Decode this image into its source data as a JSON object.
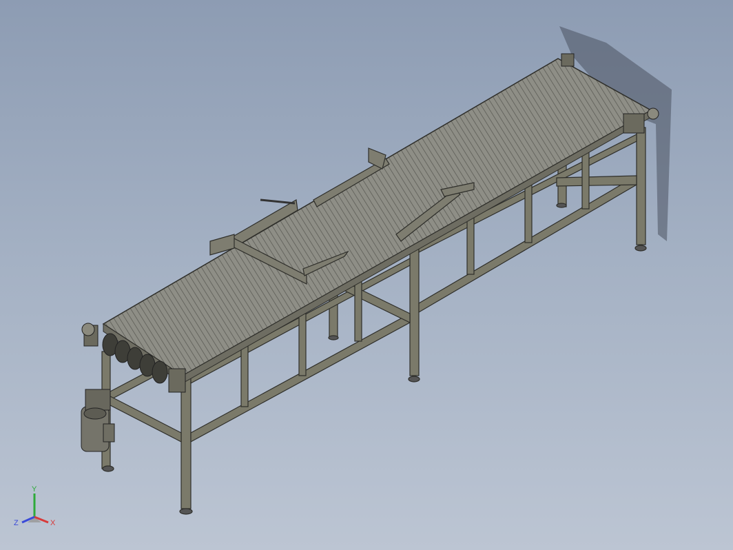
{
  "viewport": {
    "background_top": "#8d9cb3",
    "background_bottom": "#bcc5d3"
  },
  "model": {
    "name": "conveyor-assembly",
    "belt_color": "#8c8c83",
    "frame_color": "#7b7a6a",
    "edge_color": "#2e2e2a"
  },
  "triad": {
    "x_label": "X",
    "y_label": "Y",
    "z_label": "Z",
    "x_color": "#d83a3a",
    "y_color": "#2eaa3a",
    "z_color": "#3a4ad8"
  }
}
